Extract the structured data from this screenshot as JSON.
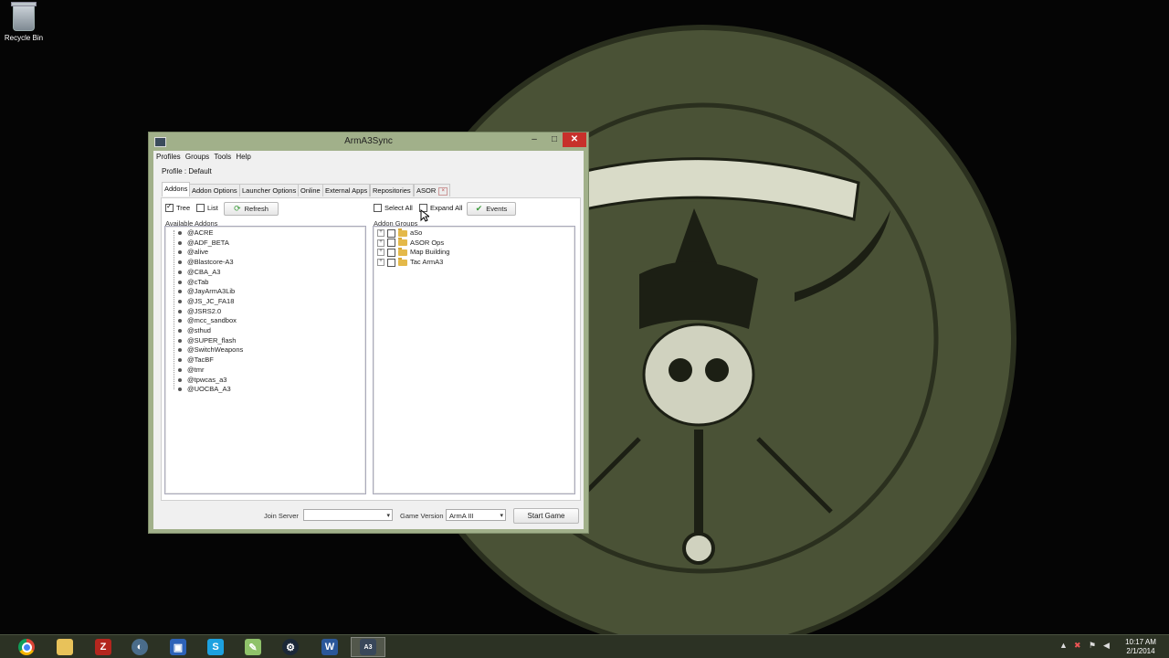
{
  "desktop": {
    "recycle_bin_label": "Recycle Bin"
  },
  "window": {
    "title": "ArmA3Sync",
    "menu": [
      "Profiles",
      "Groups",
      "Tools",
      "Help"
    ],
    "profile_label": "Profile : Default",
    "tabs": [
      "Addons",
      "Addon Options",
      "Launcher Options",
      "Online",
      "External Apps",
      "Repositories",
      "ASOR"
    ],
    "left": {
      "tree_label": "Tree",
      "list_label": "List",
      "refresh_label": "Refresh",
      "section_label": "Available Addons",
      "addons": [
        "@ACRE",
        "@ADF_BETA",
        "@alive",
        "@Blastcore-A3",
        "@CBA_A3",
        "@cTab",
        "@JayArmA3Lib",
        "@JS_JC_FA18",
        "@JSRS2.0",
        "@mcc_sandbox",
        "@sthud",
        "@SUPER_flash",
        "@SwitchWeapons",
        "@TacBF",
        "@tmr",
        "@tpwcas_a3",
        "@UOCBA_A3"
      ]
    },
    "right": {
      "select_all_label": "Select All",
      "expand_all_label": "Expand All",
      "events_label": "Events",
      "section_label": "Addon Groups",
      "groups": [
        "aSo",
        "ASOR Ops",
        "Map Building",
        "Tac ArmA3"
      ]
    },
    "bottom": {
      "join_server_label": "Join Server",
      "join_server_value": "",
      "game_version_label": "Game Version",
      "game_version_value": "ArmA III",
      "start_game_label": "Start Game"
    }
  },
  "taskbar": {
    "apps": [
      "chrome-icon",
      "explorer-icon",
      "filezilla-icon",
      "teamspeak-icon",
      "computer-icon",
      "skype-icon",
      "notepad-icon",
      "steam-icon",
      "word-icon",
      "arma3sync-icon"
    ],
    "time": "10:17 AM",
    "date": "2/1/2014"
  },
  "colors": {
    "desktop_bg": "#050505",
    "emblem": "#4a5236",
    "window_frame": "#a1b08a",
    "close_button": "#c7302b",
    "taskbar": "#2c3224"
  }
}
